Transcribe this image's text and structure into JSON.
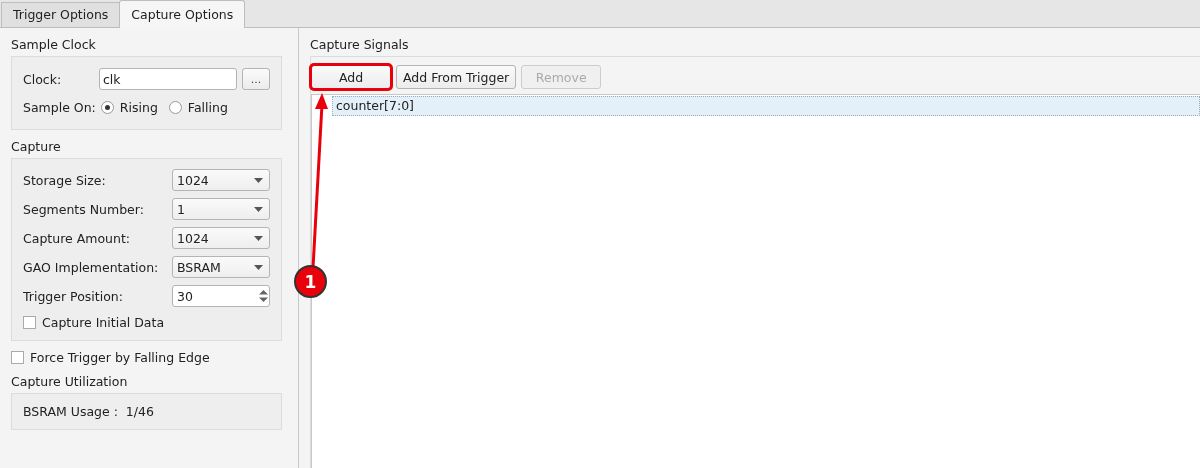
{
  "tabs": [
    {
      "label": "Trigger Options",
      "selected": false
    },
    {
      "label": "Capture Options",
      "selected": true
    }
  ],
  "sample_clock": {
    "title": "Sample Clock",
    "clock_label": "Clock:",
    "clock_value": "clk",
    "browse_button": "...",
    "sample_on_label": "Sample On:",
    "options": [
      {
        "label": "Rising",
        "selected": true
      },
      {
        "label": "Falling",
        "selected": false
      }
    ]
  },
  "capture": {
    "title": "Capture",
    "fields": [
      {
        "kind": "select",
        "label": "Storage Size:",
        "value": "1024"
      },
      {
        "kind": "select",
        "label": "Segments Number:",
        "value": "1"
      },
      {
        "kind": "select",
        "label": "Capture Amount:",
        "value": "1024"
      },
      {
        "kind": "select",
        "label": "GAO Implementation:",
        "value": "BSRAM"
      },
      {
        "kind": "spin",
        "label": "Trigger Position:",
        "value": "30"
      }
    ],
    "initial_data": {
      "label": "Capture Initial Data",
      "checked": false
    }
  },
  "force_trigger": {
    "label": "Force Trigger by Falling Edge",
    "checked": false
  },
  "utilization": {
    "title": "Capture Utilization",
    "text": "BSRAM Usage :  1/46"
  },
  "capture_signals": {
    "title": "Capture Signals",
    "buttons": [
      {
        "label": "Add",
        "disabled": false,
        "highlighted": true
      },
      {
        "label": "Add From Trigger",
        "disabled": false,
        "highlighted": false
      },
      {
        "label": "Remove",
        "disabled": true,
        "highlighted": false
      }
    ],
    "signals": [
      {
        "name": "counter[7:0]",
        "selected": true
      }
    ]
  },
  "annotation": {
    "label": "1"
  }
}
